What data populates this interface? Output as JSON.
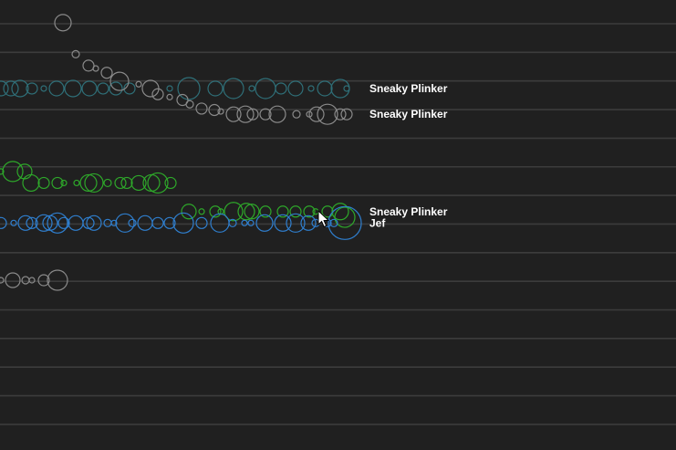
{
  "chart_data": {
    "type": "scatter",
    "title": "",
    "xlabel": "",
    "ylabel": "",
    "grid": true,
    "lane_count": 16,
    "colors": {
      "background": "#202020",
      "gridline": "#3c3c3c",
      "grey": "#8a8a8a",
      "teal": "#2f6f78",
      "green": "#2ea82a",
      "blue": "#2f7fcf",
      "label": "#ffffff"
    },
    "labels": [
      {
        "text": "Sneaky Plinker",
        "lane": 2.7
      },
      {
        "text": "Sneaky Plinker",
        "lane": 3.6
      },
      {
        "text": "Sneaky Plinker",
        "lane": 7.0
      },
      {
        "text": "Jef",
        "lane": 7.4
      }
    ],
    "series": [
      {
        "color": "teal",
        "points": [
          {
            "x": 1,
            "lane": 2.7,
            "size": 8
          },
          {
            "x": 12,
            "lane": 2.7,
            "size": 8
          },
          {
            "x": 22,
            "lane": 2.7,
            "size": 9
          },
          {
            "x": 35,
            "lane": 2.7,
            "size": 6
          },
          {
            "x": 48,
            "lane": 2.7,
            "size": 3
          },
          {
            "x": 62,
            "lane": 2.7,
            "size": 8
          },
          {
            "x": 80,
            "lane": 2.7,
            "size": 9
          },
          {
            "x": 98,
            "lane": 2.7,
            "size": 8
          },
          {
            "x": 113,
            "lane": 2.7,
            "size": 6
          },
          {
            "x": 127,
            "lane": 2.7,
            "size": 7
          },
          {
            "x": 142,
            "lane": 2.7,
            "size": 6
          },
          {
            "x": 186,
            "lane": 2.7,
            "size": 3
          },
          {
            "x": 207,
            "lane": 2.7,
            "size": 12
          },
          {
            "x": 236,
            "lane": 2.7,
            "size": 8
          },
          {
            "x": 256,
            "lane": 2.7,
            "size": 11
          },
          {
            "x": 276,
            "lane": 2.7,
            "size": 3
          },
          {
            "x": 291,
            "lane": 2.7,
            "size": 11
          },
          {
            "x": 308,
            "lane": 2.7,
            "size": 6
          },
          {
            "x": 324,
            "lane": 2.7,
            "size": 8
          },
          {
            "x": 341,
            "lane": 2.7,
            "size": 3
          },
          {
            "x": 356,
            "lane": 2.7,
            "size": 8
          },
          {
            "x": 373,
            "lane": 2.7,
            "size": 10
          },
          {
            "x": 380,
            "lane": 2.7,
            "size": 3
          }
        ]
      },
      {
        "color": "grey",
        "points": [
          {
            "x": 69,
            "lane": 0.4,
            "size": 9
          },
          {
            "x": 83,
            "lane": 1.5,
            "size": 4
          },
          {
            "x": 97,
            "lane": 1.9,
            "size": 6
          },
          {
            "x": 105,
            "lane": 2.0,
            "size": 3
          },
          {
            "x": 117,
            "lane": 2.15,
            "size": 6
          },
          {
            "x": 131,
            "lane": 2.45,
            "size": 10
          },
          {
            "x": 152,
            "lane": 2.55,
            "size": 3
          },
          {
            "x": 165,
            "lane": 2.7,
            "size": 9
          },
          {
            "x": 173,
            "lane": 2.9,
            "size": 6
          },
          {
            "x": 186,
            "lane": 3.0,
            "size": 3
          },
          {
            "x": 200,
            "lane": 3.1,
            "size": 6
          },
          {
            "x": 208,
            "lane": 3.25,
            "size": 4
          },
          {
            "x": 221,
            "lane": 3.4,
            "size": 6
          },
          {
            "x": 235,
            "lane": 3.45,
            "size": 6
          },
          {
            "x": 242,
            "lane": 3.5,
            "size": 3
          },
          {
            "x": 256,
            "lane": 3.6,
            "size": 8
          },
          {
            "x": 269,
            "lane": 3.6,
            "size": 9
          },
          {
            "x": 277,
            "lane": 3.6,
            "size": 6
          },
          {
            "x": 291,
            "lane": 3.6,
            "size": 6
          },
          {
            "x": 304,
            "lane": 3.6,
            "size": 9
          },
          {
            "x": 325,
            "lane": 3.6,
            "size": 4
          },
          {
            "x": 339,
            "lane": 3.6,
            "size": 3
          },
          {
            "x": 347,
            "lane": 3.6,
            "size": 8
          },
          {
            "x": 359,
            "lane": 3.6,
            "size": 11
          },
          {
            "x": 373,
            "lane": 3.6,
            "size": 6
          },
          {
            "x": 380,
            "lane": 3.6,
            "size": 6
          }
        ]
      },
      {
        "color": "green",
        "points": [
          {
            "x": 1,
            "lane": 5.6,
            "size": 3
          },
          {
            "x": 14,
            "lane": 5.6,
            "size": 11
          },
          {
            "x": 27,
            "lane": 5.6,
            "size": 8
          },
          {
            "x": 34,
            "lane": 6.0,
            "size": 9
          },
          {
            "x": 48,
            "lane": 6.0,
            "size": 6
          },
          {
            "x": 63,
            "lane": 6.0,
            "size": 6
          },
          {
            "x": 70,
            "lane": 6.0,
            "size": 3
          },
          {
            "x": 84,
            "lane": 6.0,
            "size": 3
          },
          {
            "x": 97,
            "lane": 6.0,
            "size": 9
          },
          {
            "x": 103,
            "lane": 6.0,
            "size": 10
          },
          {
            "x": 118,
            "lane": 6.0,
            "size": 4
          },
          {
            "x": 132,
            "lane": 6.0,
            "size": 6
          },
          {
            "x": 139,
            "lane": 6.0,
            "size": 6
          },
          {
            "x": 152,
            "lane": 6.0,
            "size": 8
          },
          {
            "x": 166,
            "lane": 6.0,
            "size": 9
          },
          {
            "x": 173,
            "lane": 6.0,
            "size": 11
          },
          {
            "x": 187,
            "lane": 6.0,
            "size": 6
          },
          {
            "x": 207,
            "lane": 7.0,
            "size": 8
          },
          {
            "x": 221,
            "lane": 7.0,
            "size": 3
          },
          {
            "x": 236,
            "lane": 7.0,
            "size": 6
          },
          {
            "x": 242,
            "lane": 7.0,
            "size": 3
          },
          {
            "x": 256,
            "lane": 7.0,
            "size": 10
          },
          {
            "x": 270,
            "lane": 7.0,
            "size": 9
          },
          {
            "x": 276,
            "lane": 7.0,
            "size": 8
          },
          {
            "x": 291,
            "lane": 7.0,
            "size": 6
          },
          {
            "x": 310,
            "lane": 7.0,
            "size": 6
          },
          {
            "x": 324,
            "lane": 7.0,
            "size": 6
          },
          {
            "x": 339,
            "lane": 7.0,
            "size": 6
          },
          {
            "x": 346,
            "lane": 7.0,
            "size": 3
          },
          {
            "x": 359,
            "lane": 7.0,
            "size": 6
          },
          {
            "x": 373,
            "lane": 7.0,
            "size": 9
          },
          {
            "x": 378,
            "lane": 7.2,
            "size": 11
          }
        ]
      },
      {
        "color": "blue",
        "points": [
          {
            "x": 1,
            "lane": 7.4,
            "size": 6
          },
          {
            "x": 15,
            "lane": 7.4,
            "size": 3
          },
          {
            "x": 28,
            "lane": 7.4,
            "size": 8
          },
          {
            "x": 35,
            "lane": 7.4,
            "size": 6
          },
          {
            "x": 48,
            "lane": 7.4,
            "size": 9
          },
          {
            "x": 55,
            "lane": 7.4,
            "size": 8
          },
          {
            "x": 63,
            "lane": 7.4,
            "size": 11
          },
          {
            "x": 70,
            "lane": 7.4,
            "size": 6
          },
          {
            "x": 83,
            "lane": 7.4,
            "size": 8
          },
          {
            "x": 97,
            "lane": 7.4,
            "size": 6
          },
          {
            "x": 103,
            "lane": 7.4,
            "size": 8
          },
          {
            "x": 118,
            "lane": 7.4,
            "size": 4
          },
          {
            "x": 125,
            "lane": 7.4,
            "size": 3
          },
          {
            "x": 137,
            "lane": 7.4,
            "size": 10
          },
          {
            "x": 145,
            "lane": 7.4,
            "size": 4
          },
          {
            "x": 159,
            "lane": 7.4,
            "size": 8
          },
          {
            "x": 173,
            "lane": 7.4,
            "size": 6
          },
          {
            "x": 186,
            "lane": 7.4,
            "size": 6
          },
          {
            "x": 201,
            "lane": 7.4,
            "size": 11
          },
          {
            "x": 221,
            "lane": 7.4,
            "size": 6
          },
          {
            "x": 241,
            "lane": 7.4,
            "size": 10
          },
          {
            "x": 255,
            "lane": 7.4,
            "size": 4
          },
          {
            "x": 268,
            "lane": 7.4,
            "size": 3
          },
          {
            "x": 275,
            "lane": 7.4,
            "size": 3
          },
          {
            "x": 290,
            "lane": 7.4,
            "size": 9
          },
          {
            "x": 310,
            "lane": 7.4,
            "size": 9
          },
          {
            "x": 324,
            "lane": 7.4,
            "size": 10
          },
          {
            "x": 338,
            "lane": 7.4,
            "size": 8
          },
          {
            "x": 346,
            "lane": 7.4,
            "size": 4
          },
          {
            "x": 359,
            "lane": 7.4,
            "size": 4
          },
          {
            "x": 366,
            "lane": 7.4,
            "size": 4
          },
          {
            "x": 378,
            "lane": 7.4,
            "size": 18
          }
        ]
      },
      {
        "color": "grey",
        "points": [
          {
            "x": 1,
            "lane": 9.4,
            "size": 3
          },
          {
            "x": 14,
            "lane": 9.4,
            "size": 8
          },
          {
            "x": 28,
            "lane": 9.4,
            "size": 4
          },
          {
            "x": 35,
            "lane": 9.4,
            "size": 3
          },
          {
            "x": 48,
            "lane": 9.4,
            "size": 6
          },
          {
            "x": 63,
            "lane": 9.4,
            "size": 11
          }
        ]
      }
    ]
  }
}
